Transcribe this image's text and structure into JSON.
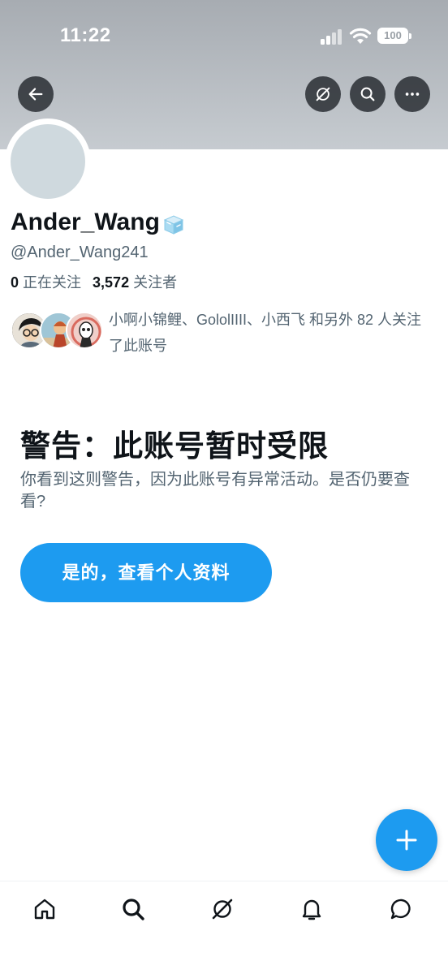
{
  "status_bar": {
    "time": "11:22",
    "battery": "100"
  },
  "header": {
    "back_icon": "arrow-left-icon",
    "grok_icon": "grok-icon",
    "search_icon": "search-icon",
    "more_icon": "more-dots-icon"
  },
  "profile": {
    "display_name": "Ander_Wang",
    "badge_icon": "ice-cube-icon",
    "handle": "@Ander_Wang241",
    "following_count": "0",
    "following_label": "正在关注",
    "followers_count": "3,572",
    "followers_label": "关注者",
    "followed_by_text": "小啊小锦鲤、GololIIII、小西飞 和另外 82 人关注了此账号"
  },
  "warning": {
    "title": "警告：此账号暂时受限",
    "body": "你看到这则警告，因为此账号有异常活动。是否仍要查看?",
    "button_label": "是的，查看个人资料"
  },
  "fab": {
    "icon": "plus-icon"
  },
  "tabbar": {
    "items": [
      "home-icon",
      "search-icon",
      "grok-icon",
      "bell-icon",
      "messages-icon"
    ]
  },
  "colors": {
    "accent": "#1d9bf0",
    "text_primary": "#0f1419",
    "text_secondary": "#536471",
    "banner": "#b8bdc2"
  }
}
